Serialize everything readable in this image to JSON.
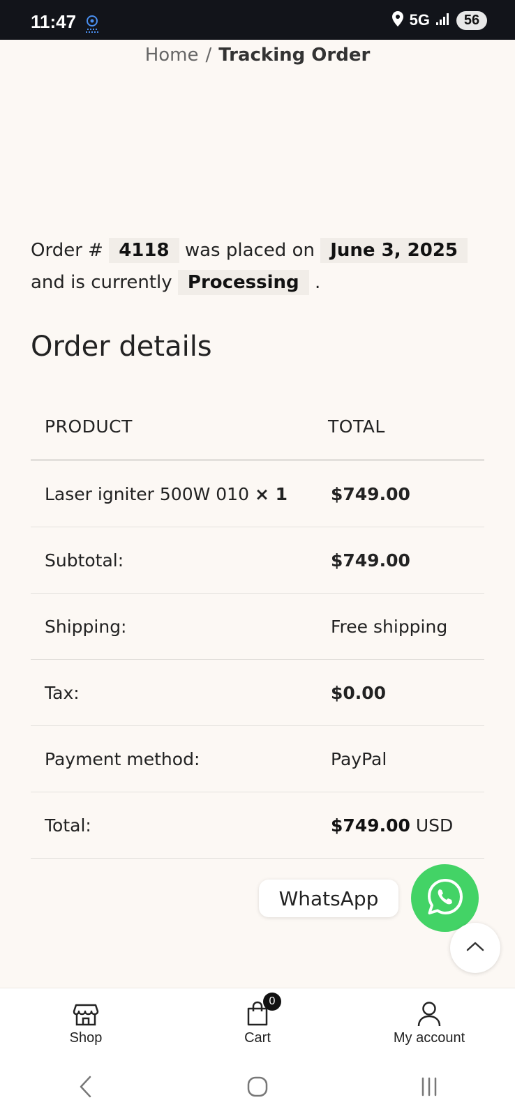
{
  "status_bar": {
    "time": "11:47",
    "network": "5G",
    "battery": "56",
    "notification_icon": "webcam-icon"
  },
  "breadcrumb": {
    "home": "Home",
    "separator": "/",
    "current": "Tracking Order"
  },
  "order_summary": {
    "prefix": "Order #",
    "order_number": "4118",
    "placed_on_text": "was placed on",
    "date": "June 3, 2025",
    "and_text": "and is currently",
    "status": "Processing",
    "period": "."
  },
  "order_details": {
    "title": "Order details",
    "headers": {
      "product": "PRODUCT",
      "total": "TOTAL"
    },
    "item": {
      "name": "Laser igniter 500W 010",
      "qty": "× 1",
      "total": "$749.00"
    },
    "subtotal": {
      "label": "Subtotal:",
      "value": "$749.00"
    },
    "shipping": {
      "label": "Shipping:",
      "value": "Free shipping"
    },
    "tax": {
      "label": "Tax:",
      "value": "$0.00"
    },
    "payment": {
      "label": "Payment method:",
      "value": "PayPal"
    },
    "total": {
      "label": "Total:",
      "value": "$749.00",
      "currency": "USD"
    }
  },
  "whatsapp": {
    "label": "WhatsApp",
    "color": "#43d366"
  },
  "bottom_nav": {
    "shop": "Shop",
    "cart": "Cart",
    "cart_count": "0",
    "account": "My account"
  }
}
